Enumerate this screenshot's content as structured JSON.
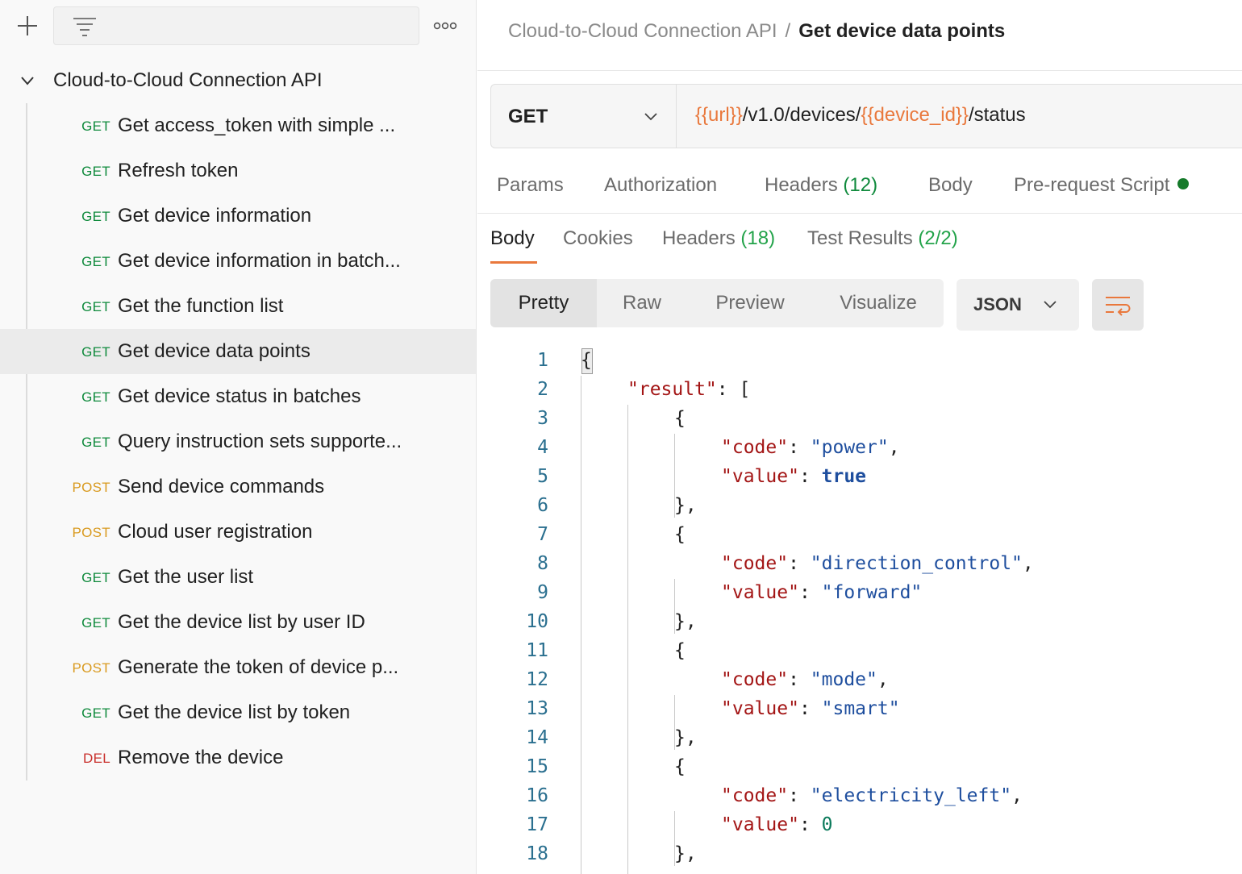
{
  "sidebar": {
    "collection_name": "Cloud-to-Cloud Connection API",
    "requests": [
      {
        "method": "GET",
        "name": "Get access_token with simple ..."
      },
      {
        "method": "GET",
        "name": "Refresh token"
      },
      {
        "method": "GET",
        "name": "Get device information"
      },
      {
        "method": "GET",
        "name": "Get device information in batch..."
      },
      {
        "method": "GET",
        "name": "Get the function list"
      },
      {
        "method": "GET",
        "name": "Get device data points"
      },
      {
        "method": "GET",
        "name": "Get device status in batches"
      },
      {
        "method": "GET",
        "name": "Query instruction sets supporte..."
      },
      {
        "method": "POST",
        "name": "Send device commands"
      },
      {
        "method": "POST",
        "name": "Cloud user registration"
      },
      {
        "method": "GET",
        "name": "Get the user list"
      },
      {
        "method": "GET",
        "name": "Get the device list by user ID"
      },
      {
        "method": "POST",
        "name": "Generate the token of device p..."
      },
      {
        "method": "GET",
        "name": "Get the device list by token"
      },
      {
        "method": "DEL",
        "name": "Remove the device"
      }
    ],
    "selected_index": 5,
    "icons": {
      "add": "plus-icon",
      "filter": "filter-icon",
      "more": "more-icon",
      "collapse": "chevron-down-icon"
    }
  },
  "method_colors": {
    "GET": "#0f8a3c",
    "POST": "#d99a1f",
    "DEL": "#c9302c"
  },
  "breadcrumb": {
    "parent": "Cloud-to-Cloud Connection API",
    "separator": "/",
    "current": "Get device data points"
  },
  "request": {
    "method": "GET",
    "url": {
      "var1": "{{url}}",
      "mid": "/v1.0/devices/",
      "var2": "{{device_id}}",
      "tail": "/status"
    }
  },
  "request_tabs": {
    "params": "Params",
    "authorization": "Authorization",
    "headers": "Headers",
    "headers_count": "(12)",
    "body": "Body",
    "pre_request": "Pre-request Script"
  },
  "response_tabs": {
    "body": "Body",
    "cookies": "Cookies",
    "headers": "Headers",
    "headers_count": "(18)",
    "tests": "Test Results",
    "tests_count": "(2/2)"
  },
  "view_modes": [
    "Pretty",
    "Raw",
    "Preview",
    "Visualize"
  ],
  "active_view": "Pretty",
  "format": "JSON",
  "colors": {
    "accent": "#e9783c",
    "count_green": "#23a34a",
    "dot_green": "#157a2a"
  },
  "code_lines": [
    {
      "n": "1",
      "indent": 0,
      "t": [
        [
          "p",
          "{"
        ]
      ]
    },
    {
      "n": "2",
      "indent": 1,
      "t": [
        [
          "k",
          "\"result\""
        ],
        [
          "p",
          ": ["
        ]
      ]
    },
    {
      "n": "3",
      "indent": 2,
      "t": [
        [
          "p",
          "{"
        ]
      ]
    },
    {
      "n": "4",
      "indent": 3,
      "t": [
        [
          "k",
          "\"code\""
        ],
        [
          "p",
          ": "
        ],
        [
          "s",
          "\"power\""
        ],
        [
          "p",
          ","
        ]
      ]
    },
    {
      "n": "5",
      "indent": 3,
      "t": [
        [
          "k",
          "\"value\""
        ],
        [
          "p",
          ": "
        ],
        [
          "b",
          "true"
        ]
      ]
    },
    {
      "n": "6",
      "indent": 2,
      "t": [
        [
          "p",
          "},"
        ]
      ]
    },
    {
      "n": "7",
      "indent": 2,
      "t": [
        [
          "p",
          "{"
        ]
      ]
    },
    {
      "n": "8",
      "indent": 3,
      "t": [
        [
          "k",
          "\"code\""
        ],
        [
          "p",
          ": "
        ],
        [
          "s",
          "\"direction_control\""
        ],
        [
          "p",
          ","
        ]
      ]
    },
    {
      "n": "9",
      "indent": 3,
      "t": [
        [
          "k",
          "\"value\""
        ],
        [
          "p",
          ": "
        ],
        [
          "s",
          "\"forward\""
        ]
      ]
    },
    {
      "n": "10",
      "indent": 2,
      "t": [
        [
          "p",
          "},"
        ]
      ]
    },
    {
      "n": "11",
      "indent": 2,
      "t": [
        [
          "p",
          "{"
        ]
      ]
    },
    {
      "n": "12",
      "indent": 3,
      "t": [
        [
          "k",
          "\"code\""
        ],
        [
          "p",
          ": "
        ],
        [
          "s",
          "\"mode\""
        ],
        [
          "p",
          ","
        ]
      ]
    },
    {
      "n": "13",
      "indent": 3,
      "t": [
        [
          "k",
          "\"value\""
        ],
        [
          "p",
          ": "
        ],
        [
          "s",
          "\"smart\""
        ]
      ]
    },
    {
      "n": "14",
      "indent": 2,
      "t": [
        [
          "p",
          "},"
        ]
      ]
    },
    {
      "n": "15",
      "indent": 2,
      "t": [
        [
          "p",
          "{"
        ]
      ]
    },
    {
      "n": "16",
      "indent": 3,
      "t": [
        [
          "k",
          "\"code\""
        ],
        [
          "p",
          ": "
        ],
        [
          "s",
          "\"electricity_left\""
        ],
        [
          "p",
          ","
        ]
      ]
    },
    {
      "n": "17",
      "indent": 3,
      "t": [
        [
          "k",
          "\"value\""
        ],
        [
          "p",
          ": "
        ],
        [
          "n",
          "0"
        ]
      ]
    },
    {
      "n": "18",
      "indent": 2,
      "t": [
        [
          "p",
          "},"
        ]
      ]
    }
  ]
}
